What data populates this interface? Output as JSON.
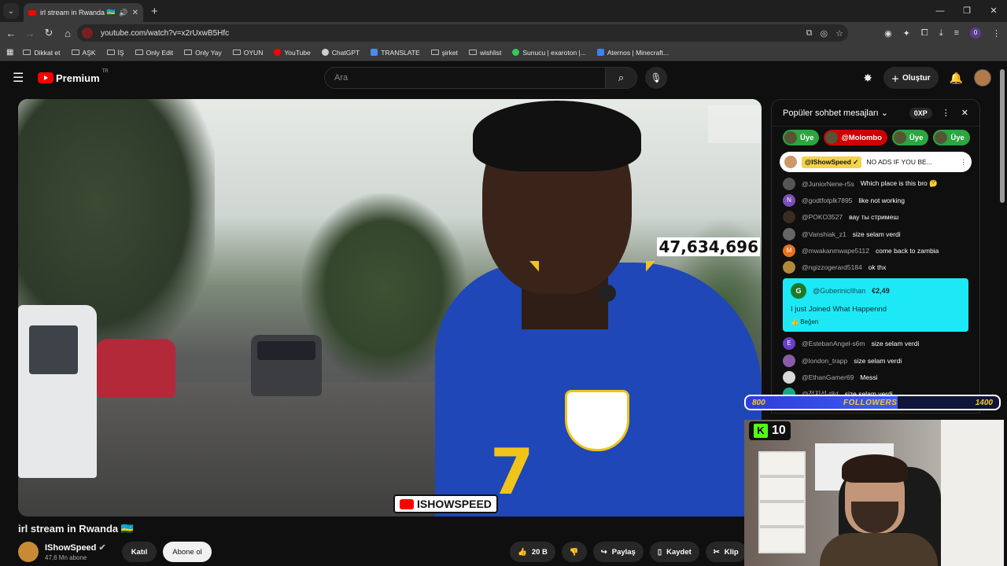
{
  "browser": {
    "tab_title": "irl stream in Rwanda 🇷🇼 - Y",
    "url": "youtube.com/watch?v=x2rUxwB5Hfc",
    "new_tab": "+",
    "window_controls": [
      "—",
      "❐",
      "✕"
    ],
    "bookmarks": [
      {
        "label": "Dikkat et",
        "icon": "folder"
      },
      {
        "label": "AŞK",
        "icon": "folder"
      },
      {
        "label": "İŞ",
        "icon": "folder"
      },
      {
        "label": "Only Edit",
        "icon": "folder"
      },
      {
        "label": "Only Yay",
        "icon": "folder"
      },
      {
        "label": "OYUN",
        "icon": "folder"
      },
      {
        "label": "YouTube",
        "icon": "youtube",
        "color": "#ff0000"
      },
      {
        "label": "ChatGPT",
        "icon": "chatgpt",
        "color": "#cfcfcf"
      },
      {
        "label": "TRANSLATE",
        "icon": "translate",
        "color": "#4a8af4"
      },
      {
        "label": "şirket",
        "icon": "folder"
      },
      {
        "label": "wishlist",
        "icon": "folder"
      },
      {
        "label": "Sunucu | exaroton |...",
        "icon": "exaroton",
        "color": "#34c759"
      },
      {
        "label": "Aternos | Minecraft...",
        "icon": "aternos",
        "color": "#3b82f6"
      }
    ],
    "profile_letter": "0"
  },
  "youtube": {
    "logo_text": "Premium",
    "logo_region": "TR",
    "search_placeholder": "Ara",
    "create_label": "Oluştur"
  },
  "video": {
    "subscriber_overlay": "47,634,696",
    "watermark": "ISHOWSPEED",
    "title": "irl stream in Rwanda 🇷🇼",
    "channel": "IShowSpeed",
    "channel_subs": "47,6 Mn abone",
    "join_label": "Katıl",
    "subscribe_label": "Abone ol",
    "likes": "20 B",
    "share_label": "Paylaş",
    "save_label": "Kaydet",
    "clip_label": "Klip"
  },
  "chat": {
    "header": "Popüler sohbet mesajları",
    "xp": "0XP",
    "pills": [
      {
        "label": "Üye",
        "color": "#2ba640"
      },
      {
        "label": "@Molombo",
        "color": "#cc0000"
      },
      {
        "label": "Üye",
        "color": "#2ba640"
      },
      {
        "label": "Üye",
        "color": "#2ba640"
      }
    ],
    "pinned": {
      "author": "@IShowSpeed ✓",
      "text": "NO ADS IF YOU BE..."
    },
    "messages_top": [
      {
        "author": "@JuniorNene-r5s",
        "text": "Which place is this bro 🤔",
        "avatar_color": "#555"
      },
      {
        "author": "@godtfotplk7895",
        "text": "like not working",
        "avatar_color": "#7b4fb8",
        "letter": "N"
      },
      {
        "author": "@POKO3527",
        "text": "вау ты стримеш",
        "avatar_color": "#3a2a22"
      },
      {
        "author": "@Vanshiak_z1",
        "text": "size selam verdi",
        "avatar_color": "#666"
      },
      {
        "author": "@mwakanmwape5112",
        "text": "come back to zambia",
        "avatar_color": "#e8711c",
        "letter": "M"
      },
      {
        "author": "@ngizzogerard5184",
        "text": "ok thx",
        "avatar_color": "#b08a3a"
      }
    ],
    "superchat": {
      "letter": "G",
      "author": "@GuberinicIlhan",
      "amount": "€2,49",
      "text": "I just Joined What Happennd",
      "like_label": "Beğen"
    },
    "messages_bottom": [
      {
        "author": "@EstebanAngel-s6m",
        "text": "size selam verdi",
        "avatar_color": "#6a3fc8",
        "letter": "E"
      },
      {
        "author": "@london_trapp",
        "text": "size selam verdi",
        "avatar_color": "#8a5ca8"
      },
      {
        "author": "@EthanGamer69",
        "text": "Messi",
        "avatar_color": "#d8d8d8"
      },
      {
        "author": "@정지선-t8d",
        "text": "size selam verdi",
        "avatar_color": "#1aa88a"
      }
    ]
  },
  "overlay": {
    "follow_left": "800",
    "follow_label": "FOLLOWERS",
    "follow_right": "1400",
    "follow_progress": 0.6,
    "kick_label": "K",
    "kick_count": "10"
  }
}
